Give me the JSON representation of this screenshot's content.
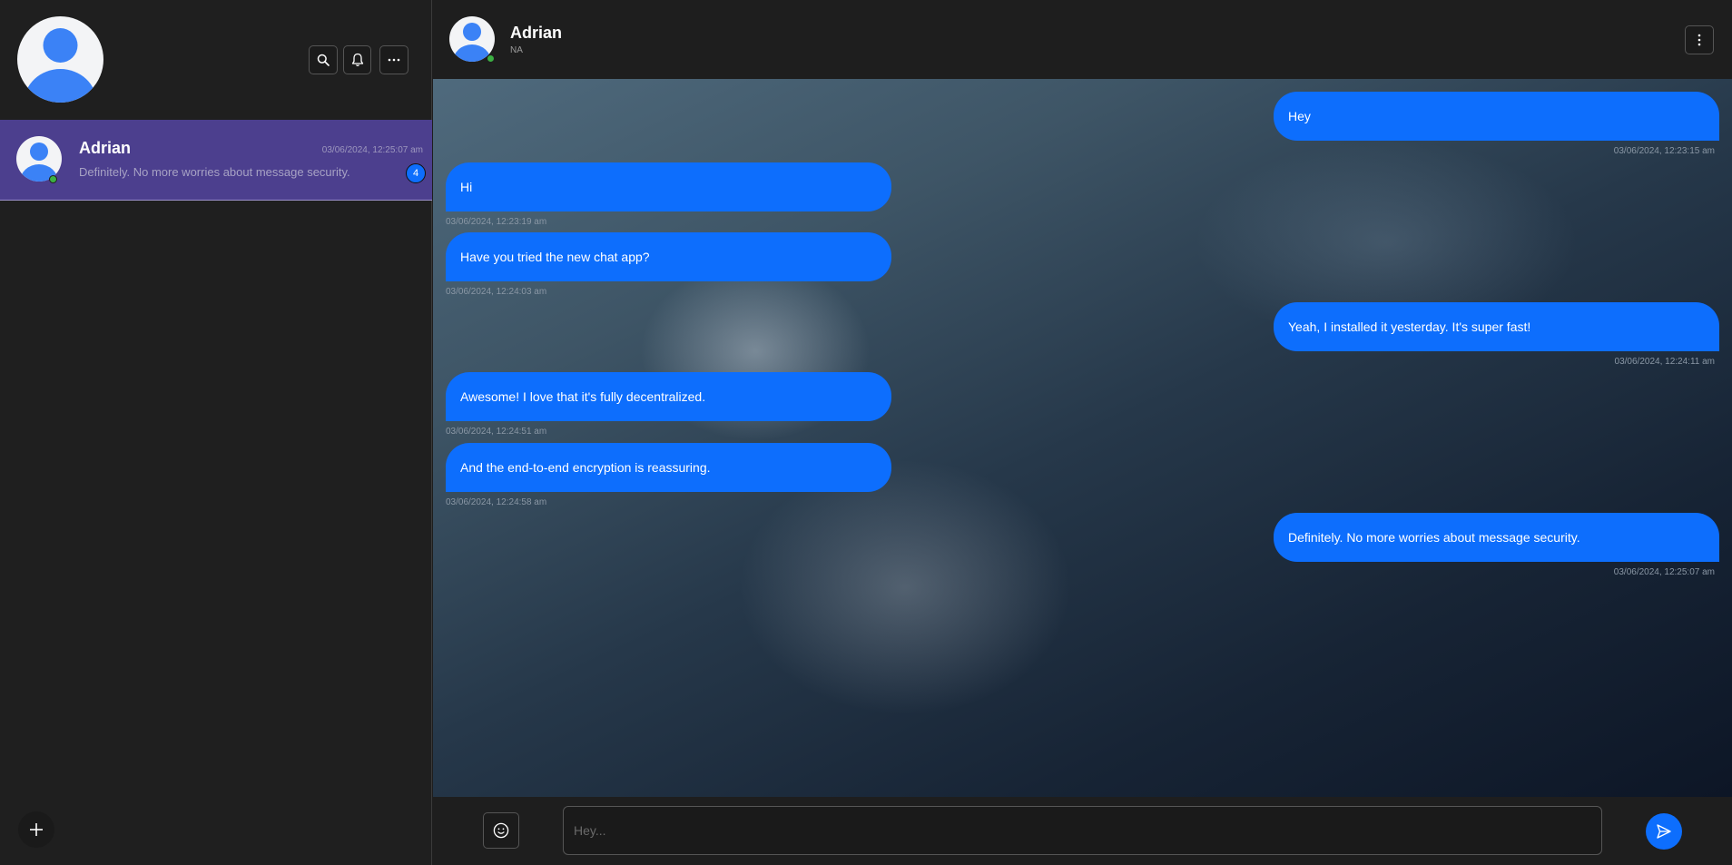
{
  "sidebar": {
    "icons": {
      "profile": "user-avatar-icon",
      "search": "search-icon",
      "notifications": "bell-icon",
      "more": "ellipsis-horizontal-icon",
      "new_chat": "plus-icon"
    },
    "chats": [
      {
        "name": "Adrian",
        "timestamp": "03/06/2024, 12:25:07 am",
        "preview": "Definitely. No more worries about message security.",
        "unread": "4",
        "online": true
      }
    ]
  },
  "chat": {
    "contact_name": "Adrian",
    "contact_status": "NA",
    "menu_icon": "ellipsis-vertical-icon",
    "messages": [
      {
        "direction": "out",
        "text": "Hey",
        "time": "03/06/2024, 12:23:15 am"
      },
      {
        "direction": "in",
        "text": "Hi",
        "time": "03/06/2024, 12:23:19 am"
      },
      {
        "direction": "in",
        "text": "Have you tried the new chat app?",
        "time": "03/06/2024, 12:24:03 am"
      },
      {
        "direction": "out",
        "text": "Yeah, I installed it yesterday. It's super fast!",
        "time": "03/06/2024, 12:24:11 am"
      },
      {
        "direction": "in",
        "text": "Awesome! I love that it's fully decentralized.",
        "time": "03/06/2024, 12:24:51 am"
      },
      {
        "direction": "in",
        "text": "And the end-to-end encryption is reassuring.",
        "time": "03/06/2024, 12:24:58 am"
      },
      {
        "direction": "out",
        "text": "Definitely. No more worries about message security.",
        "time": "03/06/2024, 12:25:07 am"
      }
    ]
  },
  "composer": {
    "placeholder": "Hey...",
    "value": "",
    "emoji_icon": "smiley-icon",
    "send_icon": "send-icon"
  },
  "colors": {
    "accent": "#0d6efd",
    "selected_chat": "#4c3f8e",
    "online": "#3cb043",
    "background": "#1e1e1e"
  }
}
